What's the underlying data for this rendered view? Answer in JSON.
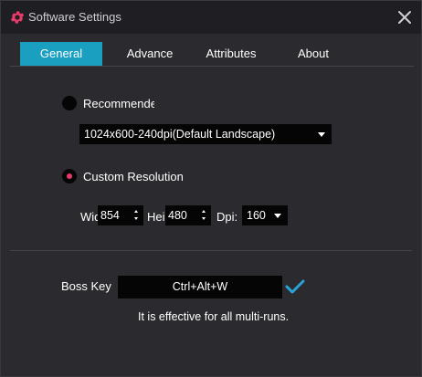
{
  "window": {
    "title": "Software Settings",
    "icon": "gear-icon",
    "close_icon": "close-icon"
  },
  "tabs": [
    {
      "label": "General",
      "active": true
    },
    {
      "label": "Advance",
      "active": false
    },
    {
      "label": "Attributes",
      "active": false
    },
    {
      "label": "About",
      "active": false
    }
  ],
  "resolution": {
    "recommended_label": "Recommended",
    "recommended_selected": false,
    "recommended_value": "1024x600-240dpi(Default Landscape)",
    "custom_label": "Custom Resolution",
    "custom_selected": true,
    "width_label": "Width",
    "width_value": "854",
    "height_label": "Height",
    "height_value": "480",
    "dpi_label": "Dpi:",
    "dpi_value": "160"
  },
  "boss_key": {
    "label": "Boss Key",
    "value": "Ctrl+Alt+W",
    "confirm_icon": "checkmark-icon",
    "note": "It is effective for all multi-runs."
  },
  "colors": {
    "accent": "#1a9fc0",
    "radio_dot": "#e83a6b",
    "check": "#2aa4d8",
    "background": "#2b2a2f",
    "titlebar": "#1f1e22"
  }
}
